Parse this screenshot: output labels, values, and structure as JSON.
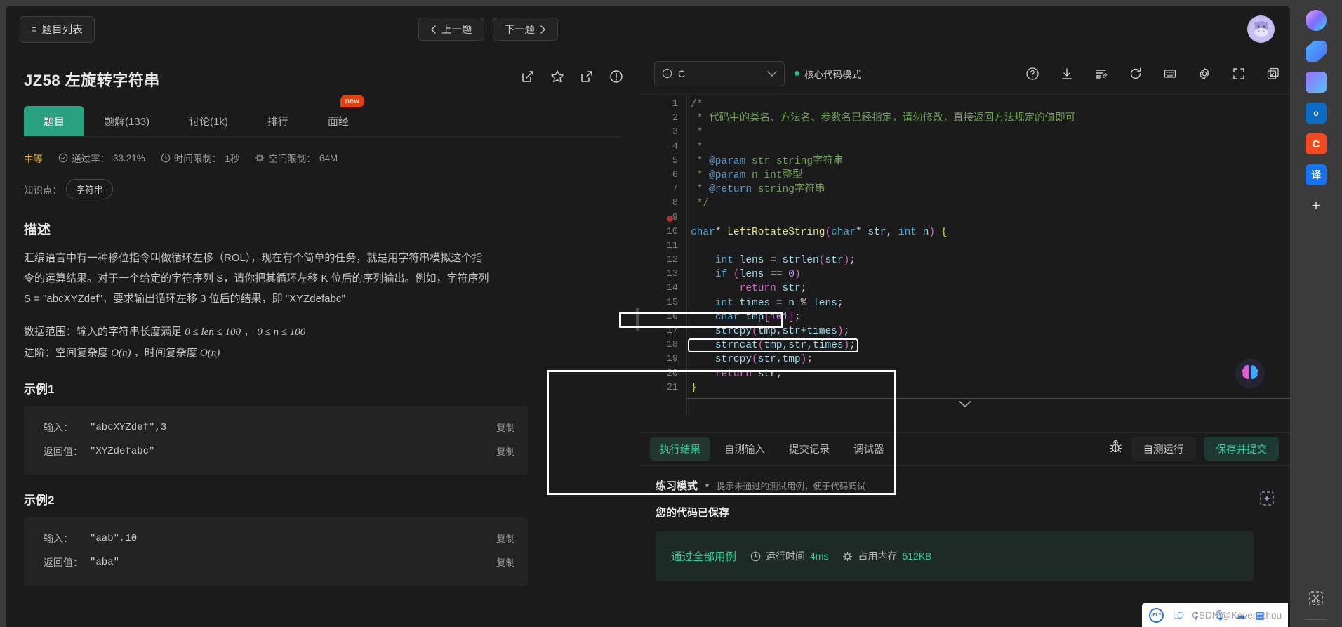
{
  "topbar": {
    "problem_list_label": "题目列表",
    "prev_label": "上一题",
    "next_label": "下一题",
    "prev_icon": "chevron-left-icon",
    "next_icon": "chevron-right-icon",
    "menu_icon": "hamburger-icon",
    "avatar_alt": "hippo-avatar"
  },
  "problem": {
    "id": "JZ58",
    "title": "左旋转字符串",
    "title_full": "JZ58  左旋转字符串",
    "icons": [
      "edit-icon",
      "star-icon",
      "share-icon",
      "report-icon"
    ],
    "tabs": [
      {
        "label": "题目",
        "active": true,
        "badge": ""
      },
      {
        "label": "题解(133)",
        "active": false,
        "badge": ""
      },
      {
        "label": "讨论(1k)",
        "active": false,
        "badge": ""
      },
      {
        "label": "排行",
        "active": false,
        "badge": ""
      },
      {
        "label": "面经",
        "active": false,
        "badge": "new"
      }
    ],
    "meta": {
      "difficulty": "中等",
      "pass_rate_label": "通过率：",
      "pass_rate_value": "33.21%",
      "time_limit_label": "时间限制：",
      "time_limit_value": "1秒",
      "space_limit_label": "空间限制：",
      "space_limit_value": "64M"
    },
    "knowledge": {
      "label": "知识点：",
      "tags": [
        "字符串"
      ]
    },
    "description_heading": "描述",
    "description_p1": "汇编语言中有一种移位指令叫做循环左移（ROL），现在有个简单的任务，就是用字符串模拟这个指令的运算结果。对于一个给定的字符序列 S，请你把其循环左移 K 位后的序列输出。例如，字符序列 S = \"abcXYZdef\"，要求输出循环左移 3 位后的结果，即 \"XYZdefabc\"",
    "data_range_label": "数据范围：输入的字符串长度满足",
    "data_range_expr1": "0 ≤ len ≤ 100",
    "data_range_sep": "，",
    "data_range_expr2": "0 ≤ n ≤ 100",
    "advanced_label": "进阶：空间复杂度",
    "advanced_expr1": "O(n)",
    "advanced_mid": "，时间复杂度",
    "advanced_expr2": "O(n)",
    "examples": [
      {
        "heading": "示例1",
        "input_label": "输入：",
        "input_value": "\"abcXYZdef\",3",
        "return_label": "返回值：",
        "return_value": "\"XYZdefabc\"",
        "copy_label": "复制"
      },
      {
        "heading": "示例2",
        "input_label": "输入：",
        "input_value": "\"aab\",10",
        "return_label": "返回值：",
        "return_value": "\"aba\"",
        "copy_label": "复制"
      }
    ]
  },
  "editor": {
    "language": "C",
    "language_info_icon": "info-circle-icon",
    "language_caret": "chevron-down-icon",
    "mode_label": "核心代码模式",
    "toolbar_icons": [
      "help-circle-icon",
      "download-icon",
      "format-code-icon",
      "reset-icon",
      "keyboard-icon",
      "settings-gear-icon",
      "fullscreen-icon",
      "close-window-icon"
    ],
    "collapse_icon": "chevron-down-icon",
    "highlighted_line": 18,
    "code_lines": [
      {
        "n": 1,
        "tokens": [
          {
            "t": "/*",
            "c": "c-com"
          }
        ]
      },
      {
        "n": 2,
        "tokens": [
          {
            "t": " * 代码中的类名、方法名、参数名已经指定，请勿修改，直接返回方法规定的值即可",
            "c": "c-com"
          }
        ]
      },
      {
        "n": 3,
        "tokens": [
          {
            "t": " *",
            "c": "c-com"
          }
        ]
      },
      {
        "n": 4,
        "tokens": [
          {
            "t": " *",
            "c": "c-com"
          }
        ]
      },
      {
        "n": 5,
        "tokens": [
          {
            "t": " * ",
            "c": "c-com"
          },
          {
            "t": "@param",
            "c": "c-doc"
          },
          {
            "t": " str string字符串",
            "c": "c-com"
          }
        ]
      },
      {
        "n": 6,
        "tokens": [
          {
            "t": " * ",
            "c": "c-com"
          },
          {
            "t": "@param",
            "c": "c-doc"
          },
          {
            "t": " n int整型",
            "c": "c-com"
          }
        ]
      },
      {
        "n": 7,
        "tokens": [
          {
            "t": " * ",
            "c": "c-com"
          },
          {
            "t": "@return",
            "c": "c-doc"
          },
          {
            "t": " string字符串",
            "c": "c-com"
          }
        ]
      },
      {
        "n": 8,
        "tokens": [
          {
            "t": " */",
            "c": "c-com"
          }
        ]
      },
      {
        "n": 9,
        "tokens": [],
        "breakpoint": true
      },
      {
        "n": 10,
        "tokens": [
          {
            "t": "char",
            "c": "c-kw"
          },
          {
            "t": "* ",
            "c": "c-plain"
          },
          {
            "t": "LeftRotateString",
            "c": "c-fn"
          },
          {
            "t": "(",
            "c": "c-pink"
          },
          {
            "t": "char",
            "c": "c-kw"
          },
          {
            "t": "* ",
            "c": "c-plain"
          },
          {
            "t": "str",
            "c": "c-var"
          },
          {
            "t": ", ",
            "c": "c-plain"
          },
          {
            "t": "int",
            "c": "c-kw"
          },
          {
            "t": " n",
            "c": "c-var"
          },
          {
            "t": ")",
            "c": "c-pink"
          },
          {
            "t": " {",
            "c": "c-y"
          }
        ]
      },
      {
        "n": 11,
        "tokens": []
      },
      {
        "n": 12,
        "tokens": [
          {
            "t": "    ",
            "c": "c-plain"
          },
          {
            "t": "int",
            "c": "c-kw"
          },
          {
            "t": " lens ",
            "c": "c-var"
          },
          {
            "t": "= ",
            "c": "c-plain"
          },
          {
            "t": "strlen",
            "c": "c-var"
          },
          {
            "t": "(",
            "c": "c-pink"
          },
          {
            "t": "str",
            "c": "c-var"
          },
          {
            "t": ")",
            "c": "c-pink"
          },
          {
            "t": ";",
            "c": "c-plain"
          }
        ]
      },
      {
        "n": 13,
        "tokens": [
          {
            "t": "    ",
            "c": "c-plain"
          },
          {
            "t": "if",
            "c": "c-kw"
          },
          {
            "t": " ",
            "c": "c-plain"
          },
          {
            "t": "(",
            "c": "c-pink"
          },
          {
            "t": "lens ",
            "c": "c-var"
          },
          {
            "t": "== ",
            "c": "c-plain"
          },
          {
            "t": "0",
            "c": "c-num"
          },
          {
            "t": ")",
            "c": "c-pink"
          }
        ]
      },
      {
        "n": 14,
        "tokens": [
          {
            "t": "        ",
            "c": "c-plain"
          },
          {
            "t": "return",
            "c": "c-pink"
          },
          {
            "t": " str",
            "c": "c-var"
          },
          {
            "t": ";",
            "c": "c-plain"
          }
        ]
      },
      {
        "n": 15,
        "tokens": [
          {
            "t": "    ",
            "c": "c-plain"
          },
          {
            "t": "int",
            "c": "c-kw"
          },
          {
            "t": " times ",
            "c": "c-var"
          },
          {
            "t": "= ",
            "c": "c-plain"
          },
          {
            "t": "n ",
            "c": "c-var"
          },
          {
            "t": "% ",
            "c": "c-plain"
          },
          {
            "t": "lens",
            "c": "c-var"
          },
          {
            "t": ";",
            "c": "c-plain"
          }
        ]
      },
      {
        "n": 16,
        "tokens": [
          {
            "t": "    ",
            "c": "c-plain"
          },
          {
            "t": "char",
            "c": "c-kw"
          },
          {
            "t": " tmp",
            "c": "c-var"
          },
          {
            "t": "[",
            "c": "c-pink"
          },
          {
            "t": "101",
            "c": "c-num"
          },
          {
            "t": "]",
            "c": "c-pink"
          },
          {
            "t": ";",
            "c": "c-plain"
          }
        ]
      },
      {
        "n": 17,
        "tokens": [
          {
            "t": "    ",
            "c": "c-plain"
          },
          {
            "t": "strcpy",
            "c": "c-var"
          },
          {
            "t": "(",
            "c": "c-pink"
          },
          {
            "t": "tmp,str+times",
            "c": "c-var"
          },
          {
            "t": ")",
            "c": "c-pink"
          },
          {
            "t": ";",
            "c": "c-plain"
          }
        ]
      },
      {
        "n": 18,
        "tokens": [
          {
            "t": "    ",
            "c": "c-plain"
          },
          {
            "t": "strncat",
            "c": "c-var"
          },
          {
            "t": "(",
            "c": "c-pink"
          },
          {
            "t": "tmp,str,times",
            "c": "c-var"
          },
          {
            "t": ")",
            "c": "c-pink"
          },
          {
            "t": ";",
            "c": "c-plain"
          }
        ],
        "highlight": true
      },
      {
        "n": 19,
        "tokens": [
          {
            "t": "    ",
            "c": "c-plain"
          },
          {
            "t": "strcpy",
            "c": "c-var"
          },
          {
            "t": "(",
            "c": "c-pink"
          },
          {
            "t": "str,tmp",
            "c": "c-var"
          },
          {
            "t": ")",
            "c": "c-pink"
          },
          {
            "t": ";",
            "c": "c-plain"
          }
        ]
      },
      {
        "n": 20,
        "tokens": [
          {
            "t": "    ",
            "c": "c-plain"
          },
          {
            "t": "return",
            "c": "c-pink"
          },
          {
            "t": " str",
            "c": "c-var"
          },
          {
            "t": ";",
            "c": "c-plain"
          }
        ]
      },
      {
        "n": 21,
        "tokens": [
          {
            "t": "}",
            "c": "c-y"
          }
        ]
      }
    ]
  },
  "result": {
    "tabs": [
      {
        "label": "执行结果",
        "active": true
      },
      {
        "label": "自测输入",
        "active": false
      },
      {
        "label": "提交记录",
        "active": false
      },
      {
        "label": "调试器",
        "active": false
      }
    ],
    "debug_icon": "bug-icon",
    "run_label": "自测运行",
    "submit_label": "保存并提交",
    "mode_name": "练习模式",
    "mode_caret": "caret-down-icon",
    "mode_hint": "提示未通过的测试用例，便于代码调试",
    "saved_message": "您的代码已保存",
    "pass_label": "通过全部用例",
    "runtime_label": "运行时间",
    "runtime_value": "4ms",
    "memory_label": "占用内存",
    "memory_value": "512KB",
    "clock_icon": "clock-icon",
    "chip_icon": "chip-icon"
  },
  "browser_sidebar": {
    "items": [
      {
        "name": "copilot-icon",
        "glyph": ""
      },
      {
        "name": "shopping-tag-icon",
        "glyph": ""
      },
      {
        "name": "collections-icon",
        "glyph": ""
      },
      {
        "name": "outlook-icon",
        "glyph": "o"
      },
      {
        "name": "c-app-icon",
        "glyph": "C"
      },
      {
        "name": "translate-icon",
        "glyph": "译"
      },
      {
        "name": "add-tool-icon",
        "glyph": "+"
      }
    ],
    "bottom_icon": "screenshot-scissors-icon"
  },
  "overlay": {
    "watermark": "CSDN @Keven-zhou",
    "ifly_label": "iFLY",
    "brain_icon": "brain-assistant-icon"
  },
  "colors": {
    "accent_green": "#28a17f",
    "success_green": "#2fcf9a",
    "badge_red": "#e8400c",
    "difficulty_yellow": "#e0b23c",
    "background": "#1b1b1b",
    "browser_chrome": "#3b3b3b"
  }
}
